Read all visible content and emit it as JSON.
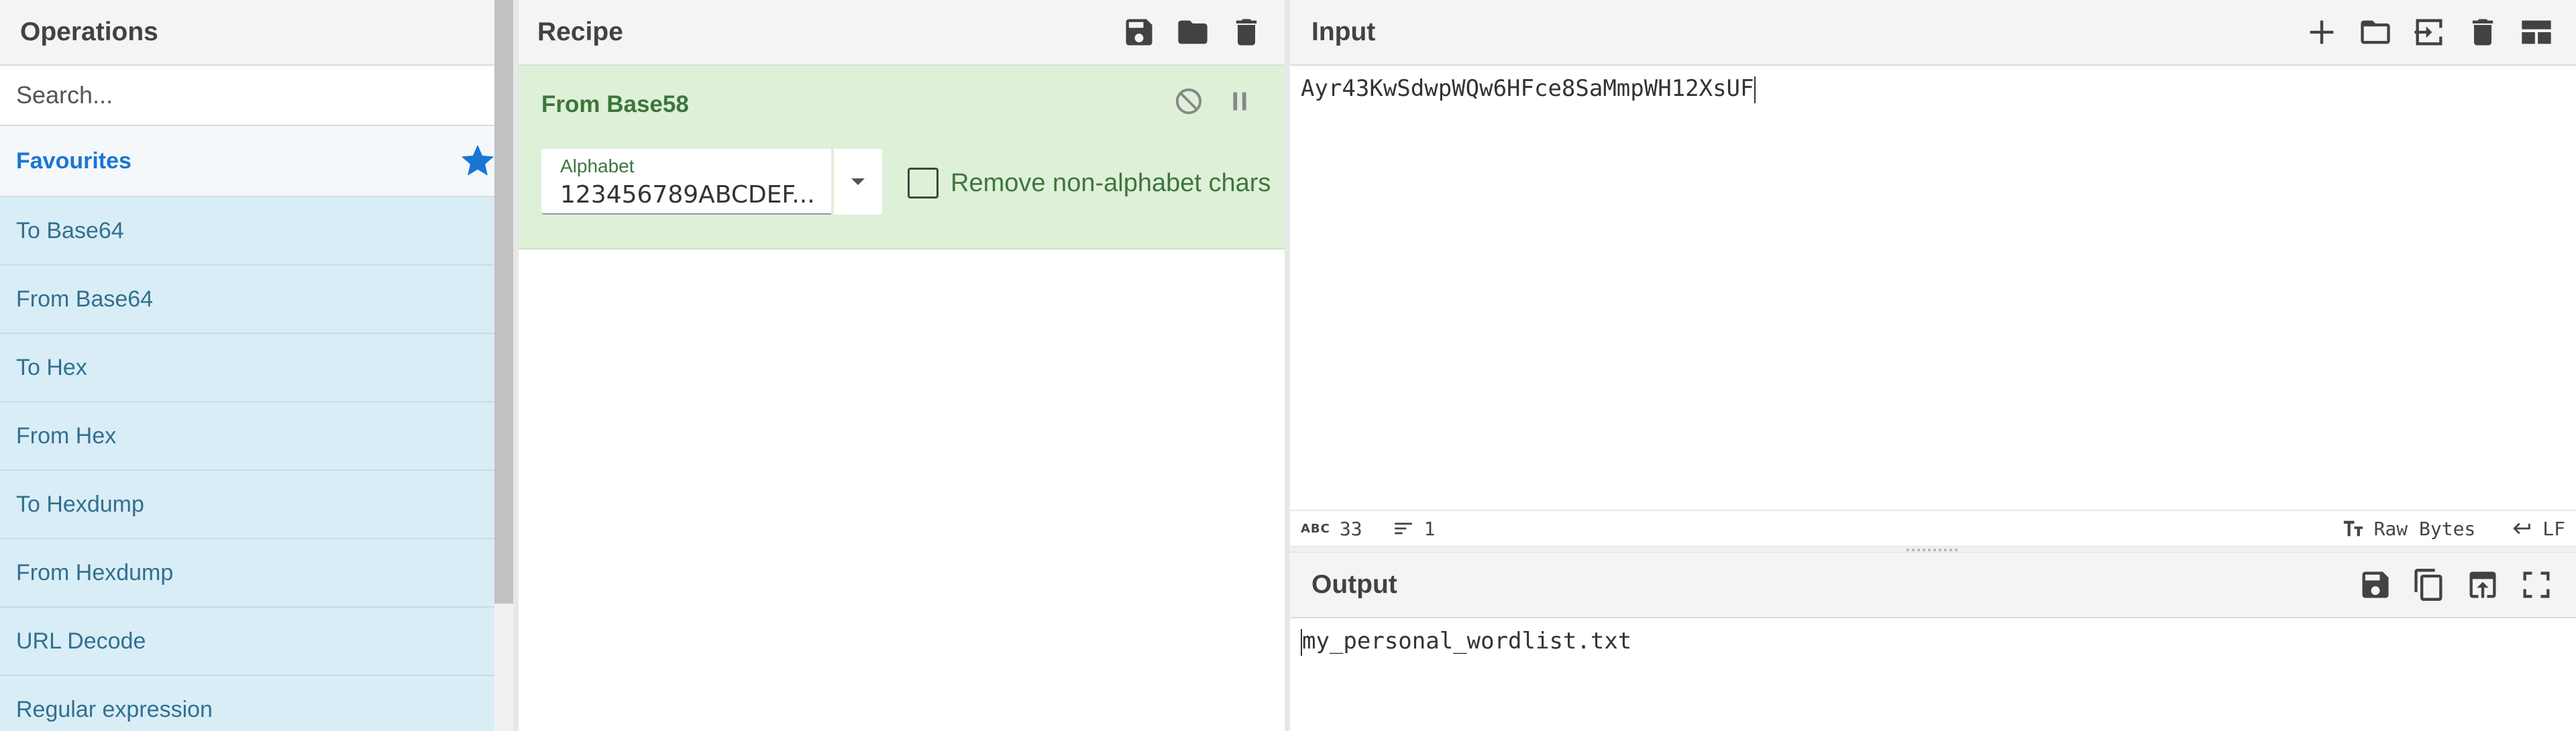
{
  "operations": {
    "title": "Operations",
    "search_placeholder": "Search...",
    "favourites_label": "Favourites",
    "items": [
      {
        "label": "To Base64"
      },
      {
        "label": "From Base64"
      },
      {
        "label": "To Hex"
      },
      {
        "label": "From Hex"
      },
      {
        "label": "To Hexdump"
      },
      {
        "label": "From Hexdump"
      },
      {
        "label": "URL Decode"
      },
      {
        "label": "Regular expression"
      }
    ]
  },
  "recipe": {
    "title": "Recipe",
    "operation": {
      "name": "From Base58",
      "alphabet_label": "Alphabet",
      "alphabet_value": "123456789ABCDEF...",
      "remove_non_alphabet_label": "Remove non-alphabet chars",
      "remove_non_alphabet_checked": false
    }
  },
  "input": {
    "title": "Input",
    "text": "Ayr43KwSdwpWQw6HFce8SaMmpWH12XsUF",
    "status": {
      "length": "33",
      "lines": "1",
      "encoding": "Raw Bytes",
      "eol": "LF"
    }
  },
  "output": {
    "title": "Output",
    "text": "my_personal_wordlist.txt"
  },
  "colors": {
    "accent": "#1976d2",
    "op_list_bg": "#d9edf7",
    "recipe_op_bg": "#dff0d8",
    "recipe_op_text": "#3c763d"
  }
}
